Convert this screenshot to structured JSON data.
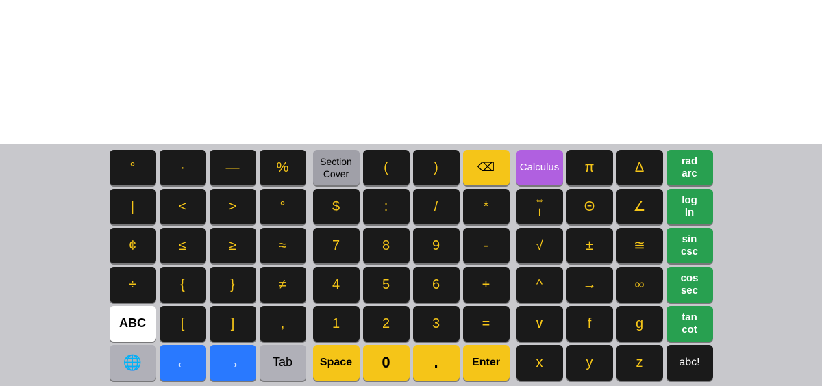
{
  "keyboard": {
    "section1": {
      "rows": [
        [
          "°",
          "·",
          "—",
          "%"
        ],
        [
          "|",
          "<",
          ">",
          "°"
        ],
        [
          "¢",
          "≤",
          "≥",
          "≈"
        ],
        [
          "÷",
          "{",
          "}",
          "≠"
        ],
        [
          "ABC",
          "[",
          "]",
          ","
        ],
        [
          "🌐",
          "←",
          "→",
          "Tab"
        ]
      ]
    },
    "section2": {
      "rows": [
        [
          "Section\nCover",
          "(",
          ")",
          "⌫"
        ],
        [
          "$",
          ":",
          "/",
          "*"
        ],
        [
          "7",
          "8",
          "9",
          "-"
        ],
        [
          "4",
          "5",
          "6",
          "+"
        ],
        [
          "1",
          "2",
          "3",
          "="
        ],
        [
          "Space",
          "0",
          ".",
          "Enter"
        ]
      ]
    },
    "section3": {
      "rows": [
        [
          "Calculus",
          "π",
          "Δ",
          "rad\narc"
        ],
        [
          "⇔\n⊥",
          "Θ",
          "∠",
          "log\nln"
        ],
        [
          "√",
          "±",
          "≅",
          "sin\ncsc"
        ],
        [
          "^",
          "→",
          "∞",
          "cos\nsec"
        ],
        [
          "∨",
          "f",
          "g",
          "tan\ncot"
        ],
        [
          "x",
          "y",
          "z",
          "abc!"
        ]
      ]
    }
  }
}
